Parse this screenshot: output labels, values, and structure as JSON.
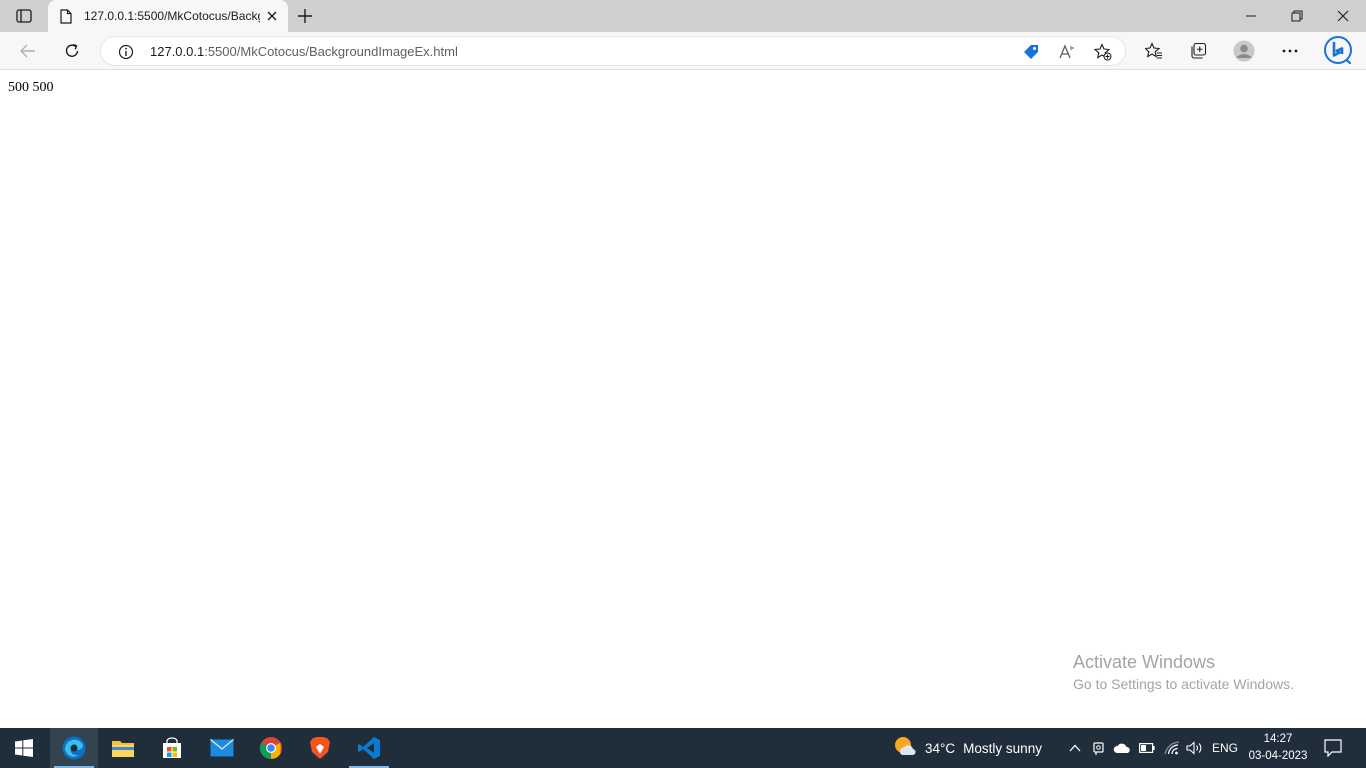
{
  "browser": {
    "tab": {
      "title": "127.0.0.1:5500/MkCotocus/Backg",
      "favicon": "page-icon"
    },
    "address": {
      "host": "127.0.0.1",
      "path": ":5500/MkCotocus/BackgroundImageEx.html",
      "info_icon": "info-icon"
    },
    "toolbar_icons": [
      "back-icon",
      "refresh-icon",
      "shopping-tag-icon",
      "read-aloud-icon",
      "add-favorite-icon",
      "favorites-icon",
      "collections-icon",
      "profile-icon",
      "more-icon",
      "bing-icon"
    ],
    "window_controls": [
      "minimize-icon",
      "restore-icon",
      "close-icon"
    ]
  },
  "page": {
    "text": "500 500"
  },
  "watermark": {
    "title": "Activate Windows",
    "subtitle": "Go to Settings to activate Windows."
  },
  "taskbar": {
    "apps": [
      "start-icon",
      "edge-icon",
      "file-explorer-icon",
      "store-icon",
      "mail-icon",
      "chrome-icon",
      "brave-icon",
      "vscode-icon"
    ],
    "weather": {
      "temp": "34°C",
      "condition": "Mostly sunny"
    },
    "language": "ENG",
    "time": "14:27",
    "date": "03-04-2023"
  },
  "colors": {
    "tabstrip": "#cfcfcf",
    "toolbar": "#f7f7f7",
    "taskbar": "#1f2e3a",
    "edge_blue": "#0078d4",
    "vscode_blue": "#0a7bd3",
    "brave_orange": "#f25420",
    "watermark": "#a4a4a4"
  }
}
